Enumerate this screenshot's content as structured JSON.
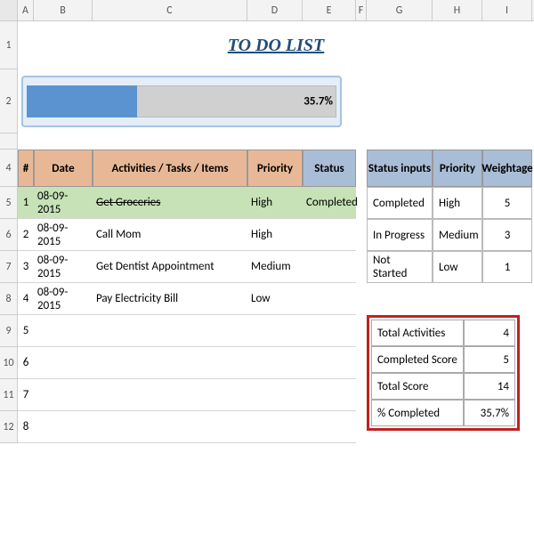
{
  "columns": [
    "A",
    "B",
    "C",
    "D",
    "E",
    "F",
    "G",
    "H",
    "I"
  ],
  "title": "TO DO LIST",
  "progress": {
    "percent": 35.7,
    "label": "35.7%"
  },
  "todo": {
    "headers": {
      "num": "#",
      "date": "Date",
      "activity": "Activities / Tasks / Items",
      "priority": "Priority",
      "status": "Status"
    },
    "rows": [
      {
        "num": "1",
        "date": "08-09-2015",
        "activity": "Get Groceries",
        "priority": "High",
        "status": "Completed",
        "completed": true
      },
      {
        "num": "2",
        "date": "08-09-2015",
        "activity": "Call Mom",
        "priority": "High",
        "status": "",
        "completed": false
      },
      {
        "num": "3",
        "date": "08-09-2015",
        "activity": "Get Dentist Appointment",
        "priority": "Medium",
        "status": "",
        "completed": false
      },
      {
        "num": "4",
        "date": "08-09-2015",
        "activity": "Pay Electricity Bill",
        "priority": "Low",
        "status": "",
        "completed": false
      },
      {
        "num": "5",
        "date": "",
        "activity": "",
        "priority": "",
        "status": "",
        "completed": false
      },
      {
        "num": "6",
        "date": "",
        "activity": "",
        "priority": "",
        "status": "",
        "completed": false
      },
      {
        "num": "7",
        "date": "",
        "activity": "",
        "priority": "",
        "status": "",
        "completed": false
      },
      {
        "num": "8",
        "date": "",
        "activity": "",
        "priority": "",
        "status": "",
        "completed": false
      }
    ]
  },
  "lookup": {
    "headers": {
      "status": "Status inputs",
      "priority": "Priority",
      "weight": "Weightage"
    },
    "rows": [
      {
        "status": "Completed",
        "priority": "High",
        "weight": "5"
      },
      {
        "status": "In Progress",
        "priority": "Medium",
        "weight": "3"
      },
      {
        "status": "Not Started",
        "priority": "Low",
        "weight": "1"
      }
    ]
  },
  "summary": {
    "rows": [
      {
        "label": "Total Activities",
        "value": "4"
      },
      {
        "label": "Completed Score",
        "value": "5"
      },
      {
        "label": "Total Score",
        "value": "14"
      },
      {
        "label": "% Completed",
        "value": "35.7%"
      }
    ]
  },
  "rowNumbers": [
    "1",
    "2",
    "",
    "4",
    "5",
    "6",
    "7",
    "8",
    "9",
    "10",
    "11",
    "12"
  ]
}
